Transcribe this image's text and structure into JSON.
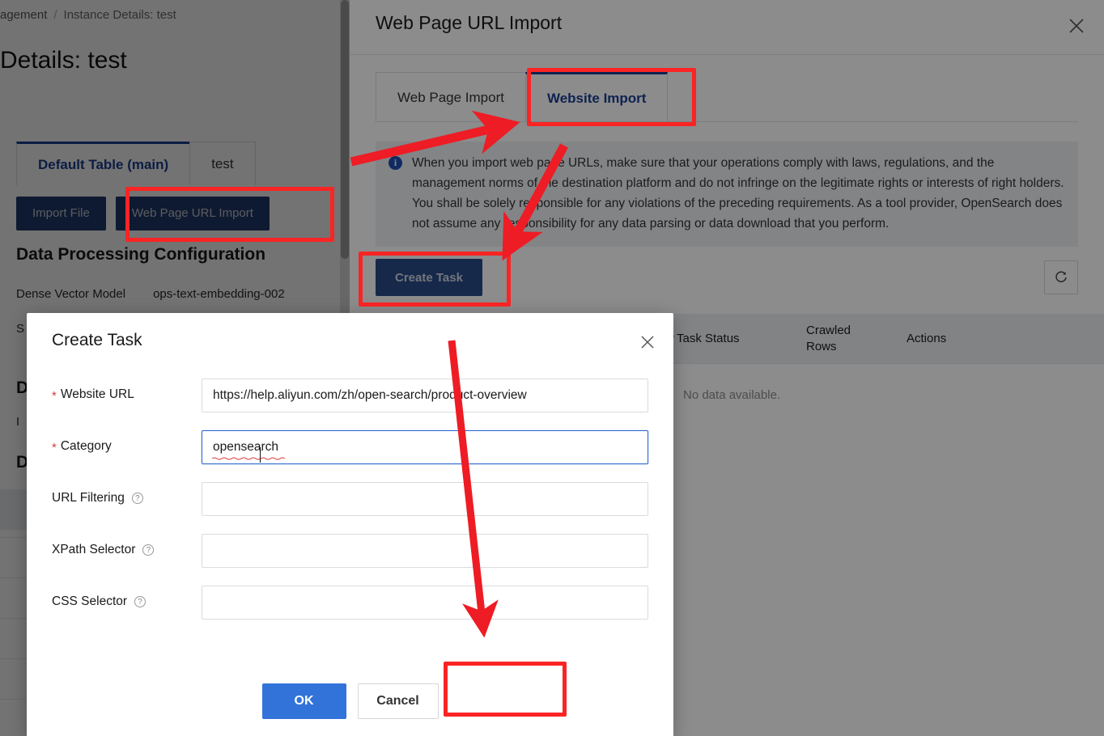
{
  "background_page": {
    "breadcrumb": {
      "parent": "agement",
      "separator": "/",
      "current": "Instance Details: test"
    },
    "title": "Details: test",
    "tabs": [
      {
        "label": "Default Table (main)",
        "active": true
      },
      {
        "label": "test",
        "active": false
      }
    ],
    "buttons": {
      "import_file": "Import File",
      "web_page_url_import": "Web Page URL Import"
    },
    "section_title": "Data Processing Configuration",
    "fields": [
      {
        "label": "Dense Vector Model",
        "value": "ops-text-embedding-002"
      },
      {
        "label": "S",
        "value": ""
      }
    ],
    "truncated_headings": [
      "D",
      "D"
    ],
    "truncated_text": "I"
  },
  "drawer": {
    "title": "Web Page URL Import",
    "close_icon": "close-icon",
    "tabs": [
      {
        "label": "Web Page Import",
        "active": false
      },
      {
        "label": "Website Import",
        "active": true
      }
    ],
    "notice": {
      "icon": "info-icon",
      "text": "When you import web page URLs, make sure that your operations comply with laws, regulations, and the management norms of the destination platform and do not infringe on the legitimate rights or interests of right holders. You shall be solely responsible for any violations of the preceding requirements. As a tool provider, OpenSearch does not assume any responsibility for any data parsing or data download that you perform."
    },
    "create_task_button": "Create Task",
    "refresh_icon": "refresh-icon",
    "table": {
      "columns": [
        "ory",
        "Task Status",
        "Crawled Rows",
        "Actions"
      ],
      "empty_text": "No data available."
    }
  },
  "modal": {
    "title": "Create Task",
    "close_icon": "close-icon",
    "fields": [
      {
        "label": "Website URL",
        "required": true,
        "has_help": false,
        "value": "https://help.aliyun.com/zh/open-search/product-overview",
        "placeholder": "",
        "focused": false
      },
      {
        "label": "Category",
        "required": true,
        "has_help": false,
        "value": "opensearch",
        "placeholder": "",
        "focused": true
      },
      {
        "label": "URL Filtering",
        "required": false,
        "has_help": true,
        "value": "",
        "placeholder": "",
        "focused": false
      },
      {
        "label": "XPath Selector",
        "required": false,
        "has_help": true,
        "value": "",
        "placeholder": "",
        "focused": false
      },
      {
        "label": "CSS Selector",
        "required": false,
        "has_help": true,
        "value": "",
        "placeholder": "",
        "focused": false
      }
    ],
    "ok_label": "OK",
    "cancel_label": "Cancel"
  },
  "annotations": {
    "highlight_color": "#fb2424",
    "boxes": [
      {
        "name": "web-page-url-import-highlight"
      },
      {
        "name": "website-import-tab-highlight"
      },
      {
        "name": "create-task-button-highlight"
      },
      {
        "name": "ok-button-highlight"
      }
    ],
    "arrows": [
      {
        "name": "arrow-to-website-import-tab"
      },
      {
        "name": "arrow-to-create-task-button"
      },
      {
        "name": "arrow-to-ok-button"
      }
    ]
  },
  "colors": {
    "accent_blue": "#1c3f94",
    "primary_button": "#3273d9",
    "dark_button": "#1f3a6e",
    "annotation_red": "#fb2424",
    "notice_bg": "#eef0f5"
  }
}
